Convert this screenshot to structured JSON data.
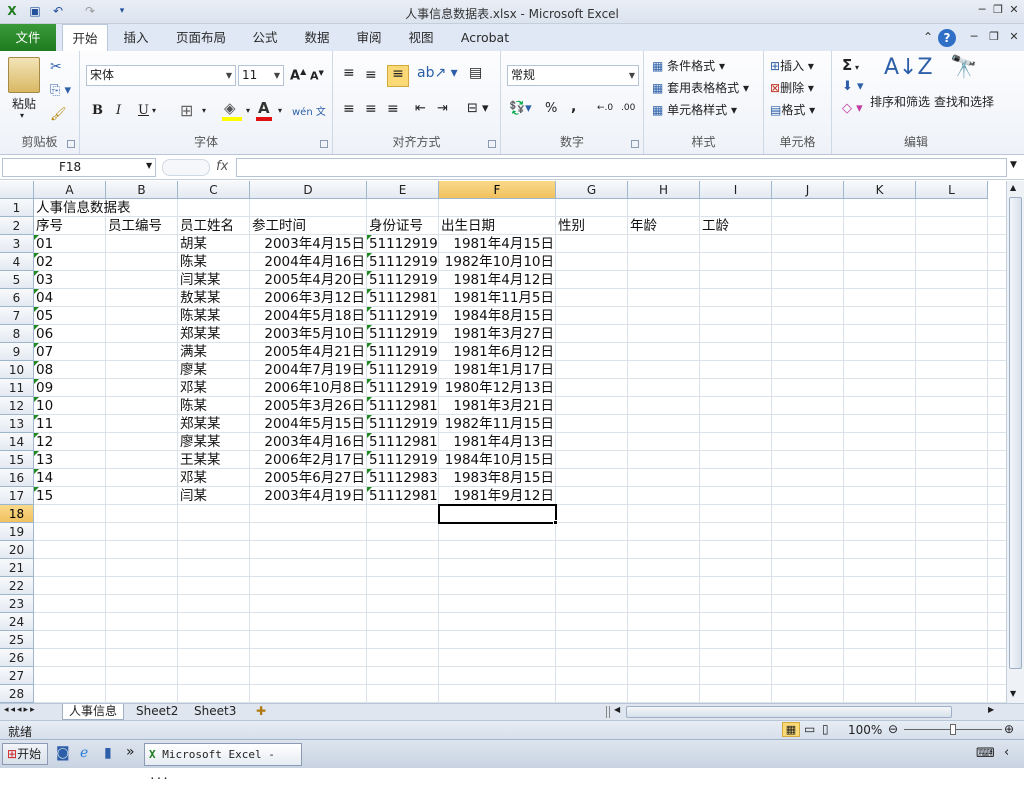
{
  "window": {
    "title": "人事信息数据表.xlsx - Microsoft Excel"
  },
  "ribbon_tabs": [
    "文件",
    "开始",
    "插入",
    "页面布局",
    "公式",
    "数据",
    "审阅",
    "视图",
    "Acrobat"
  ],
  "active_tab": "开始",
  "clipboard": {
    "paste": "粘贴",
    "group": "剪贴板"
  },
  "font": {
    "name": "宋体",
    "size": "11",
    "group": "字体",
    "bold": "B",
    "italic": "I",
    "underline": "U",
    "font_color": "A",
    "wen": "wén 文"
  },
  "align": {
    "group": "对齐方式"
  },
  "number": {
    "format": "常规",
    "group": "数字",
    "percent": "%",
    "comma": ",",
    "inc": "+.0 .00",
    "dec": ".00 →.0"
  },
  "styles": {
    "cond": "条件格式",
    "table": "套用表格格式",
    "cell": "单元格样式",
    "group": "样式"
  },
  "cells": {
    "insert": "插入",
    "delete": "删除",
    "format": "格式",
    "group": "单元格"
  },
  "editing": {
    "sort": "排序和筛选",
    "find": "查找和选择",
    "group": "编辑",
    "sigma": "Σ"
  },
  "formula_bar": {
    "name_box": "F18",
    "fx": "fx",
    "content": ""
  },
  "columns": [
    "A",
    "B",
    "C",
    "D",
    "E",
    "F",
    "G",
    "H",
    "I",
    "J",
    "K",
    "L"
  ],
  "rows": [
    "1",
    "2",
    "3",
    "4",
    "5",
    "6",
    "7",
    "8",
    "9",
    "10",
    "11",
    "12",
    "13",
    "14",
    "15",
    "16",
    "17",
    "18",
    "19",
    "20",
    "21",
    "22",
    "23",
    "24",
    "25",
    "26",
    "27",
    "28"
  ],
  "selected_cell": {
    "col": "F",
    "row": "18"
  },
  "sheet": {
    "title": "人事信息数据表",
    "headers": [
      "序号",
      "员工编号",
      "员工姓名",
      "参工时间",
      "身份证号",
      "出生日期",
      "性别",
      "年龄",
      "工龄"
    ],
    "data": [
      [
        "01",
        "",
        "胡某",
        "2003年4月15日",
        "51112919…",
        "1981年4月15日"
      ],
      [
        "02",
        "",
        "陈某",
        "2004年4月16日",
        "51112919…",
        "1982年10月10日"
      ],
      [
        "03",
        "",
        "闫某某",
        "2005年4月20日",
        "51112919…",
        "1981年4月12日"
      ],
      [
        "04",
        "",
        "敖某某",
        "2006年3月12日",
        "51112981…",
        "1981年11月5日"
      ],
      [
        "05",
        "",
        "陈某某",
        "2004年5月18日",
        "51112919…",
        "1984年8月15日"
      ],
      [
        "06",
        "",
        "郑某某",
        "2003年5月10日",
        "51112919…",
        "1981年3月27日"
      ],
      [
        "07",
        "",
        "满某",
        "2005年4月21日",
        "51112919…",
        "1981年6月12日"
      ],
      [
        "08",
        "",
        "廖某",
        "2004年7月19日",
        "51112919…",
        "1981年1月17日"
      ],
      [
        "09",
        "",
        "邓某",
        "2006年10月8日",
        "51112919…",
        "1980年12月13日"
      ],
      [
        "10",
        "",
        "陈某",
        "2005年3月26日",
        "51112981…",
        "1981年3月21日"
      ],
      [
        "11",
        "",
        "郑某某",
        "2004年5月15日",
        "51112919…",
        "1982年11月15日"
      ],
      [
        "12",
        "",
        "廖某某",
        "2003年4月16日",
        "51112981…",
        "1981年4月13日"
      ],
      [
        "13",
        "",
        "王某某",
        "2006年2月17日",
        "51112919…",
        "1984年10月15日"
      ],
      [
        "14",
        "",
        "邓某",
        "2005年6月27日",
        "51112983…",
        "1983年8月15日"
      ],
      [
        "15",
        "",
        "闫某",
        "2003年4月19日",
        "51112981…",
        "1981年9月12日"
      ]
    ]
  },
  "sheet_tabs": [
    "人事信息",
    "Sheet2",
    "Sheet3"
  ],
  "active_sheet": "人事信息",
  "status": {
    "ready": "就绪",
    "zoom": "100%"
  },
  "taskbar": {
    "start": "开始",
    "app": "Microsoft Excel - ..."
  }
}
